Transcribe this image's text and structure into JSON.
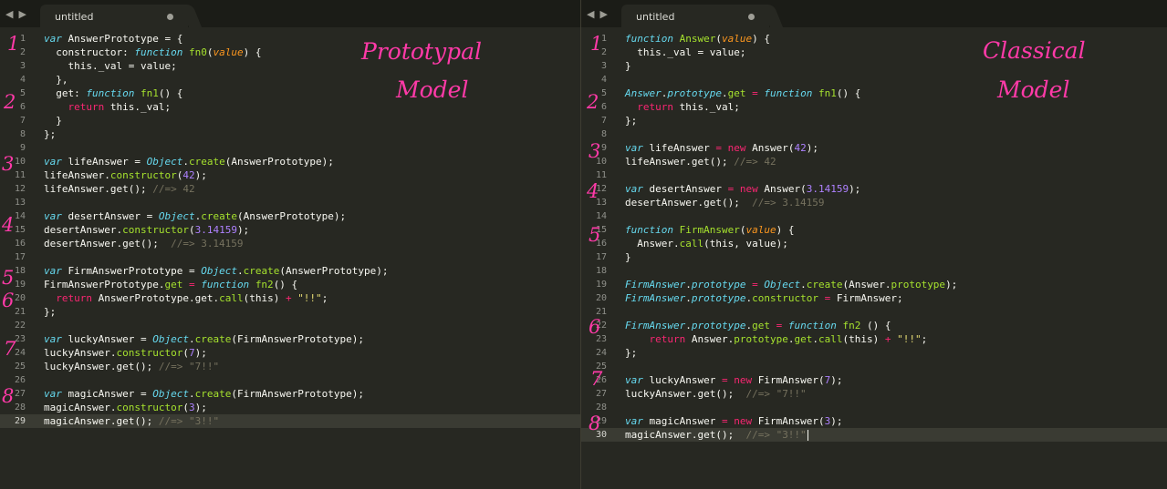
{
  "colors": {
    "background": "#272822",
    "keyword": "#66d9ef",
    "function_name": "#a6e22e",
    "parameter": "#fd971f",
    "operator": "#f92672",
    "number": "#ae81ff",
    "string": "#e6db74",
    "comment": "#75715e",
    "annotation": "#ff3aa8"
  },
  "left": {
    "tab": {
      "title": "untitled",
      "back_icon": "triangle-left-icon",
      "forward_icon": "triangle-right-icon",
      "dirty_icon": "dot-icon"
    },
    "annotation": [
      "Prototypal",
      "Model"
    ],
    "markers": [
      "1",
      "2",
      "3",
      "4",
      "5",
      "6",
      "7",
      "8"
    ],
    "active_line": 29,
    "lines": [
      [
        [
          "k",
          "var"
        ],
        [
          "t",
          " AnswerPrototype = {"
        ]
      ],
      [
        [
          "t",
          "  constructor: "
        ],
        [
          "k",
          "function"
        ],
        [
          "t",
          " "
        ],
        [
          "f",
          "fn0"
        ],
        [
          "t",
          "("
        ],
        [
          "p",
          "value"
        ],
        [
          "t",
          ") {"
        ]
      ],
      [
        [
          "t",
          "    this._val = value;"
        ]
      ],
      [
        [
          "t",
          "  },"
        ]
      ],
      [
        [
          "t",
          "  get: "
        ],
        [
          "k",
          "function"
        ],
        [
          "t",
          " "
        ],
        [
          "f",
          "fn1"
        ],
        [
          "t",
          "() {"
        ]
      ],
      [
        [
          "t",
          "    "
        ],
        [
          "r",
          "return"
        ],
        [
          "t",
          " this._val;"
        ]
      ],
      [
        [
          "t",
          "  }"
        ]
      ],
      [
        [
          "t",
          "};"
        ]
      ],
      [
        [
          "t",
          ""
        ]
      ],
      [
        [
          "k",
          "var"
        ],
        [
          "t",
          " lifeAnswer = "
        ],
        [
          "k",
          "Object"
        ],
        [
          "t",
          "."
        ],
        [
          "f",
          "create"
        ],
        [
          "t",
          "(AnswerPrototype);"
        ]
      ],
      [
        [
          "t",
          "lifeAnswer."
        ],
        [
          "f",
          "constructor"
        ],
        [
          "t",
          "("
        ],
        [
          "n",
          "42"
        ],
        [
          "t",
          ");"
        ]
      ],
      [
        [
          "t",
          "lifeAnswer.get(); "
        ],
        [
          "c",
          "//=> 42"
        ]
      ],
      [
        [
          "t",
          ""
        ]
      ],
      [
        [
          "k",
          "var"
        ],
        [
          "t",
          " desertAnswer = "
        ],
        [
          "k",
          "Object"
        ],
        [
          "t",
          "."
        ],
        [
          "f",
          "create"
        ],
        [
          "t",
          "(AnswerPrototype);"
        ]
      ],
      [
        [
          "t",
          "desertAnswer."
        ],
        [
          "f",
          "constructor"
        ],
        [
          "t",
          "("
        ],
        [
          "n",
          "3.14159"
        ],
        [
          "t",
          ");"
        ]
      ],
      [
        [
          "t",
          "desertAnswer.get();  "
        ],
        [
          "c",
          "//=> 3.14159"
        ]
      ],
      [
        [
          "t",
          ""
        ]
      ],
      [
        [
          "k",
          "var"
        ],
        [
          "t",
          " FirmAnswerPrototype = "
        ],
        [
          "k",
          "Object"
        ],
        [
          "t",
          "."
        ],
        [
          "f",
          "create"
        ],
        [
          "t",
          "(AnswerPrototype);"
        ]
      ],
      [
        [
          "t",
          "FirmAnswerPrototype."
        ],
        [
          "f",
          "get"
        ],
        [
          "t",
          " "
        ],
        [
          "o",
          "="
        ],
        [
          "t",
          " "
        ],
        [
          "k",
          "function"
        ],
        [
          "t",
          " "
        ],
        [
          "f",
          "fn2"
        ],
        [
          "t",
          "() {"
        ]
      ],
      [
        [
          "t",
          "  "
        ],
        [
          "r",
          "return"
        ],
        [
          "t",
          " AnswerPrototype.get."
        ],
        [
          "f",
          "call"
        ],
        [
          "t",
          "(this) "
        ],
        [
          "o",
          "+"
        ],
        [
          "t",
          " "
        ],
        [
          "s",
          "\"!!\""
        ],
        [
          "t",
          ";"
        ]
      ],
      [
        [
          "t",
          "};"
        ]
      ],
      [
        [
          "t",
          ""
        ]
      ],
      [
        [
          "k",
          "var"
        ],
        [
          "t",
          " luckyAnswer = "
        ],
        [
          "k",
          "Object"
        ],
        [
          "t",
          "."
        ],
        [
          "f",
          "create"
        ],
        [
          "t",
          "(FirmAnswerPrototype);"
        ]
      ],
      [
        [
          "t",
          "luckyAnswer."
        ],
        [
          "f",
          "constructor"
        ],
        [
          "t",
          "("
        ],
        [
          "n",
          "7"
        ],
        [
          "t",
          ");"
        ]
      ],
      [
        [
          "t",
          "luckyAnswer.get(); "
        ],
        [
          "c",
          "//=> \"7!!\""
        ]
      ],
      [
        [
          "t",
          ""
        ]
      ],
      [
        [
          "k",
          "var"
        ],
        [
          "t",
          " magicAnswer = "
        ],
        [
          "k",
          "Object"
        ],
        [
          "t",
          "."
        ],
        [
          "f",
          "create"
        ],
        [
          "t",
          "(FirmAnswerPrototype);"
        ]
      ],
      [
        [
          "t",
          "magicAnswer."
        ],
        [
          "f",
          "constructor"
        ],
        [
          "t",
          "("
        ],
        [
          "n",
          "3"
        ],
        [
          "t",
          ");"
        ]
      ],
      [
        [
          "t",
          "magicAnswer.get(); "
        ],
        [
          "c",
          "//=> \"3!!\""
        ]
      ]
    ]
  },
  "right": {
    "tab": {
      "title": "untitled",
      "back_icon": "triangle-left-icon",
      "forward_icon": "triangle-right-icon",
      "dirty_icon": "dot-icon"
    },
    "annotation": [
      "Classical",
      "Model"
    ],
    "markers": [
      "1",
      "2",
      "3",
      "4",
      "5",
      "6",
      "7",
      "8"
    ],
    "active_line": 30,
    "lines": [
      [
        [
          "k",
          "function"
        ],
        [
          "t",
          " "
        ],
        [
          "f",
          "Answer"
        ],
        [
          "t",
          "("
        ],
        [
          "p",
          "value"
        ],
        [
          "t",
          ") {"
        ]
      ],
      [
        [
          "t",
          "  this._val = value;"
        ]
      ],
      [
        [
          "t",
          "}"
        ]
      ],
      [
        [
          "t",
          ""
        ]
      ],
      [
        [
          "k",
          "Answer"
        ],
        [
          "t",
          "."
        ],
        [
          "k",
          "prototype"
        ],
        [
          "t",
          "."
        ],
        [
          "f",
          "get"
        ],
        [
          "t",
          " "
        ],
        [
          "o",
          "="
        ],
        [
          "t",
          " "
        ],
        [
          "k",
          "function"
        ],
        [
          "t",
          " "
        ],
        [
          "f",
          "fn1"
        ],
        [
          "t",
          "() {"
        ]
      ],
      [
        [
          "t",
          "  "
        ],
        [
          "r",
          "return"
        ],
        [
          "t",
          " this._val;"
        ]
      ],
      [
        [
          "t",
          "};"
        ]
      ],
      [
        [
          "t",
          ""
        ]
      ],
      [
        [
          "k",
          "var"
        ],
        [
          "t",
          " lifeAnswer "
        ],
        [
          "o",
          "="
        ],
        [
          "t",
          " "
        ],
        [
          "r",
          "new"
        ],
        [
          "t",
          " Answer("
        ],
        [
          "n",
          "42"
        ],
        [
          "t",
          ");"
        ]
      ],
      [
        [
          "t",
          "lifeAnswer.get(); "
        ],
        [
          "c",
          "//=> 42"
        ]
      ],
      [
        [
          "t",
          ""
        ]
      ],
      [
        [
          "k",
          "var"
        ],
        [
          "t",
          " desertAnswer "
        ],
        [
          "o",
          "="
        ],
        [
          "t",
          " "
        ],
        [
          "r",
          "new"
        ],
        [
          "t",
          " Answer("
        ],
        [
          "n",
          "3.14159"
        ],
        [
          "t",
          ");"
        ]
      ],
      [
        [
          "t",
          "desertAnswer.get();  "
        ],
        [
          "c",
          "//=> 3.14159"
        ]
      ],
      [
        [
          "t",
          ""
        ]
      ],
      [
        [
          "k",
          "function"
        ],
        [
          "t",
          " "
        ],
        [
          "f",
          "FirmAnswer"
        ],
        [
          "t",
          "("
        ],
        [
          "p",
          "value"
        ],
        [
          "t",
          ") {"
        ]
      ],
      [
        [
          "t",
          "  Answer."
        ],
        [
          "f",
          "call"
        ],
        [
          "t",
          "(this, value);"
        ]
      ],
      [
        [
          "t",
          "}"
        ]
      ],
      [
        [
          "t",
          ""
        ]
      ],
      [
        [
          "k",
          "FirmAnswer"
        ],
        [
          "t",
          "."
        ],
        [
          "k",
          "prototype"
        ],
        [
          "t",
          " "
        ],
        [
          "o",
          "="
        ],
        [
          "t",
          " "
        ],
        [
          "k",
          "Object"
        ],
        [
          "t",
          "."
        ],
        [
          "f",
          "create"
        ],
        [
          "t",
          "(Answer."
        ],
        [
          "f",
          "prototype"
        ],
        [
          "t",
          ");"
        ]
      ],
      [
        [
          "k",
          "FirmAnswer"
        ],
        [
          "t",
          "."
        ],
        [
          "k",
          "prototype"
        ],
        [
          "t",
          "."
        ],
        [
          "f",
          "constructor"
        ],
        [
          "t",
          " "
        ],
        [
          "o",
          "="
        ],
        [
          "t",
          " FirmAnswer;"
        ]
      ],
      [
        [
          "t",
          ""
        ]
      ],
      [
        [
          "k",
          "FirmAnswer"
        ],
        [
          "t",
          "."
        ],
        [
          "k",
          "prototype"
        ],
        [
          "t",
          "."
        ],
        [
          "f",
          "get"
        ],
        [
          "t",
          " "
        ],
        [
          "o",
          "="
        ],
        [
          "t",
          " "
        ],
        [
          "k",
          "function"
        ],
        [
          "t",
          " "
        ],
        [
          "f",
          "fn2"
        ],
        [
          "t",
          " () {"
        ]
      ],
      [
        [
          "t",
          "    "
        ],
        [
          "r",
          "return"
        ],
        [
          "t",
          " Answer."
        ],
        [
          "f",
          "prototype"
        ],
        [
          "t",
          "."
        ],
        [
          "f",
          "get"
        ],
        [
          "t",
          "."
        ],
        [
          "f",
          "call"
        ],
        [
          "t",
          "(this) "
        ],
        [
          "o",
          "+"
        ],
        [
          "t",
          " "
        ],
        [
          "s",
          "\"!!\""
        ],
        [
          "t",
          ";"
        ]
      ],
      [
        [
          "t",
          "};"
        ]
      ],
      [
        [
          "t",
          ""
        ]
      ],
      [
        [
          "k",
          "var"
        ],
        [
          "t",
          " luckyAnswer "
        ],
        [
          "o",
          "="
        ],
        [
          "t",
          " "
        ],
        [
          "r",
          "new"
        ],
        [
          "t",
          " FirmAnswer("
        ],
        [
          "n",
          "7"
        ],
        [
          "t",
          ");"
        ]
      ],
      [
        [
          "t",
          "luckyAnswer.get();  "
        ],
        [
          "c",
          "//=> \"7!!\""
        ]
      ],
      [
        [
          "t",
          ""
        ]
      ],
      [
        [
          "k",
          "var"
        ],
        [
          "t",
          " magicAnswer "
        ],
        [
          "o",
          "="
        ],
        [
          "t",
          " "
        ],
        [
          "r",
          "new"
        ],
        [
          "t",
          " FirmAnswer("
        ],
        [
          "n",
          "3"
        ],
        [
          "t",
          ");"
        ]
      ],
      [
        [
          "t",
          "magicAnswer.get();  "
        ],
        [
          "c",
          "//=> \"3!!\""
        ]
      ]
    ]
  }
}
